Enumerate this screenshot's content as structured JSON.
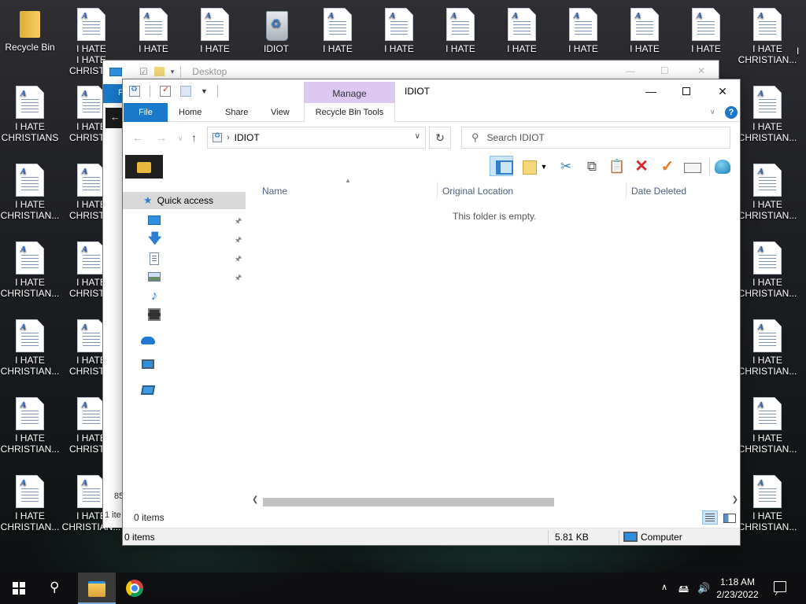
{
  "desktop": {
    "recycle_bin_label": "Recycle Bin",
    "hate_label_1": "I HATE",
    "hate_label_2": "I HATE",
    "hate_label_3": "I HATE",
    "idiot_label": "IDIOT",
    "hate_label_4": "I HATE",
    "hate_label_5": "I HATE",
    "hate_label_6": "I HATE",
    "hate_label_7": "I HATE",
    "hate_label_8": "I HATE",
    "hate_label_9": "I HATE",
    "hate_label_10": "I HATE",
    "hate_right_1": "I HATE CHRISTIAN...",
    "col1": [
      "I HATE CHRISTIANS",
      "I HATE CHRISTIAN...",
      "I HATE CHRISTIAN...",
      "I HATE CHRISTIAN...",
      "I HATE CHRISTIAN...",
      "I HATE CHRISTIAN..."
    ],
    "col2_top": "I HATE CHRISTIA",
    "col2": [
      "I HATE CHRISTIA",
      "I HATE CHRISTIA",
      "I HATE CHRISTIA",
      "I HATE CHRISTIA",
      "I HATE CHRISTIA",
      "I HATE CHRISTIAN..."
    ],
    "col_right": [
      "I HATE CHRISTIAN...",
      "I HATE CHRISTIAN...",
      "I HATE CHRISTIAN...",
      "I HATE CHRISTIAN...",
      "I HATE CHRISTIAN...",
      "I HATE CHRISTIAN..."
    ],
    "edge_top": "I"
  },
  "back_window": {
    "title": "Desktop",
    "tab_letter": "F",
    "stub_count": "85",
    "stub_items": "1 ite"
  },
  "window": {
    "title": "IDIOT",
    "manage_label": "Manage",
    "tabs": {
      "file": "File",
      "home": "Home",
      "share": "Share",
      "view": "View",
      "recycle_bin_tools": "Recycle Bin Tools"
    },
    "help_label": "?",
    "address": {
      "path": "IDIOT"
    },
    "search_placeholder": "Search IDIOT",
    "nav": {
      "quick_access": "Quick access"
    },
    "columns": {
      "name": "Name",
      "original_location": "Original Location",
      "date_deleted": "Date Deleted"
    },
    "empty_message": "This folder is empty.",
    "inner_status": "0 items",
    "status": {
      "items": "0 items",
      "size": "5.81 KB",
      "location": "Computer"
    }
  },
  "taskbar": {
    "time": "1:18 AM",
    "date": "2/23/2022"
  }
}
